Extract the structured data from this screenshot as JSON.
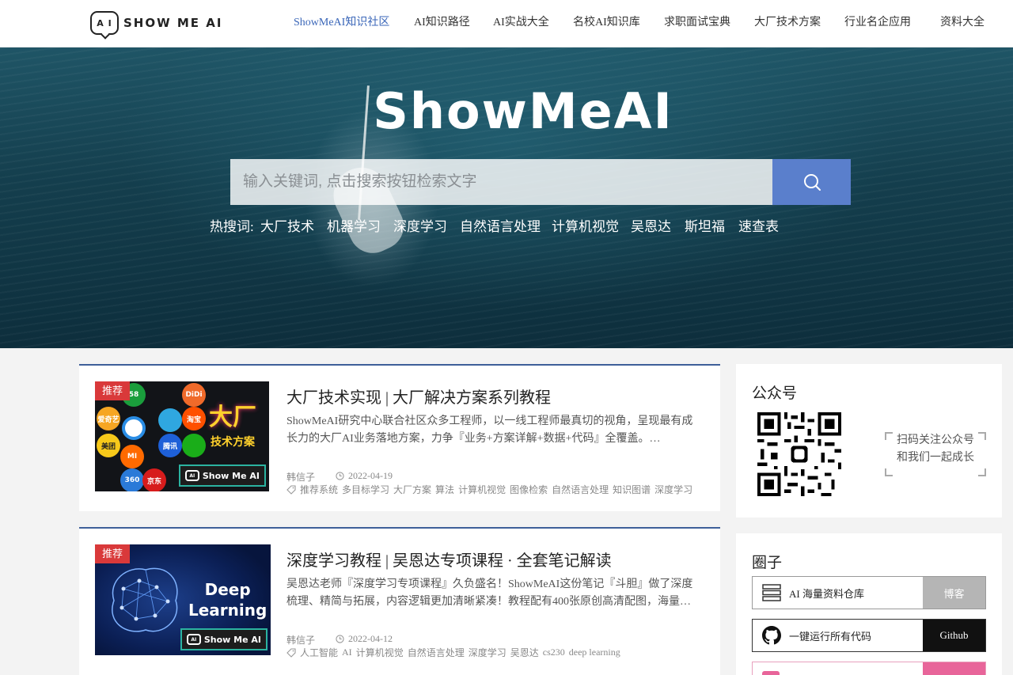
{
  "header": {
    "logo_text": "SHOW ME AI",
    "nav": [
      {
        "label": "ShowMeAI知识社区",
        "active": true
      },
      {
        "label": "AI知识路径"
      },
      {
        "label": "AI实战大全"
      },
      {
        "label": "名校AI知识库"
      },
      {
        "label": "求职面试宝典"
      },
      {
        "label": "大厂技术方案"
      },
      {
        "label": "行业名企应用"
      },
      {
        "label": "资料大全"
      }
    ]
  },
  "hero": {
    "title": "ShowMeAI",
    "search_placeholder": "输入关键词, 点击搜索按钮检索文字",
    "hot_label": "热搜词:",
    "hot_words": [
      "大厂技术",
      "机器学习",
      "深度学习",
      "自然语言处理",
      "计算机视觉",
      "吴恩达",
      "斯坦福",
      "速查表"
    ]
  },
  "articles": [
    {
      "badge": "推荐",
      "title": "大厂技术实现 | 大厂解决方案系列教程",
      "description": "ShowMeAI研究中心联合社区众多工程师，以一线工程师最真切的视角，呈现最有成长力的大厂AI业务落地方案，力争『业务+方案详解+数据+代码』全覆盖。@ShowMeAI",
      "author": "韩信子",
      "date": "2022-04-19",
      "tags": [
        "推荐系统",
        "多目标学习",
        "大厂方案",
        "算法",
        "计算机视觉",
        "图像检索",
        "自然语言处理",
        "知识图谱",
        "深度学习"
      ],
      "thumb": {
        "headline": "大厂",
        "subline": "技术方案",
        "stamp": "Show Me AI",
        "logos": [
          "爱奇艺",
          "58",
          "美团",
          "MI",
          "腾讯",
          "360",
          "DiDi",
          "淘宝",
          "京东"
        ]
      }
    },
    {
      "badge": "推荐",
      "title": "深度学习教程 | 吴恩达专项课程 · 全套笔记解读",
      "description": "吴恩达老师『深度学习专项课程』久负盛名！ShowMeAI这份笔记『斗胆』做了深度梳理、精简与拓展，内容逻辑更加清晰紧凑！教程配有400张原创高清配图，海量案例与代码实现",
      "author": "韩信子",
      "date": "2022-04-12",
      "tags": [
        "人工智能",
        "AI",
        "计算机视觉",
        "自然语言处理",
        "深度学习",
        "吴恩达",
        "cs230",
        "deep learning"
      ],
      "thumb": {
        "headline_1": "Deep",
        "headline_2": "Learning",
        "stamp": "Show Me AI"
      }
    }
  ],
  "sidebar": {
    "wechat": {
      "title": "公众号",
      "note_line_1": "扫码关注公众号",
      "note_line_2": "和我们一起成长"
    },
    "circle": {
      "title": "圈子",
      "rows": [
        {
          "label": "AI 海量资料仓库",
          "action": "博客",
          "action_color": "#b5b5b5"
        },
        {
          "label": "一键运行所有代码",
          "action": "Github",
          "action_color": "#111111"
        },
        {
          "label": "",
          "action": "",
          "action_color": "#e8659a"
        }
      ]
    }
  }
}
